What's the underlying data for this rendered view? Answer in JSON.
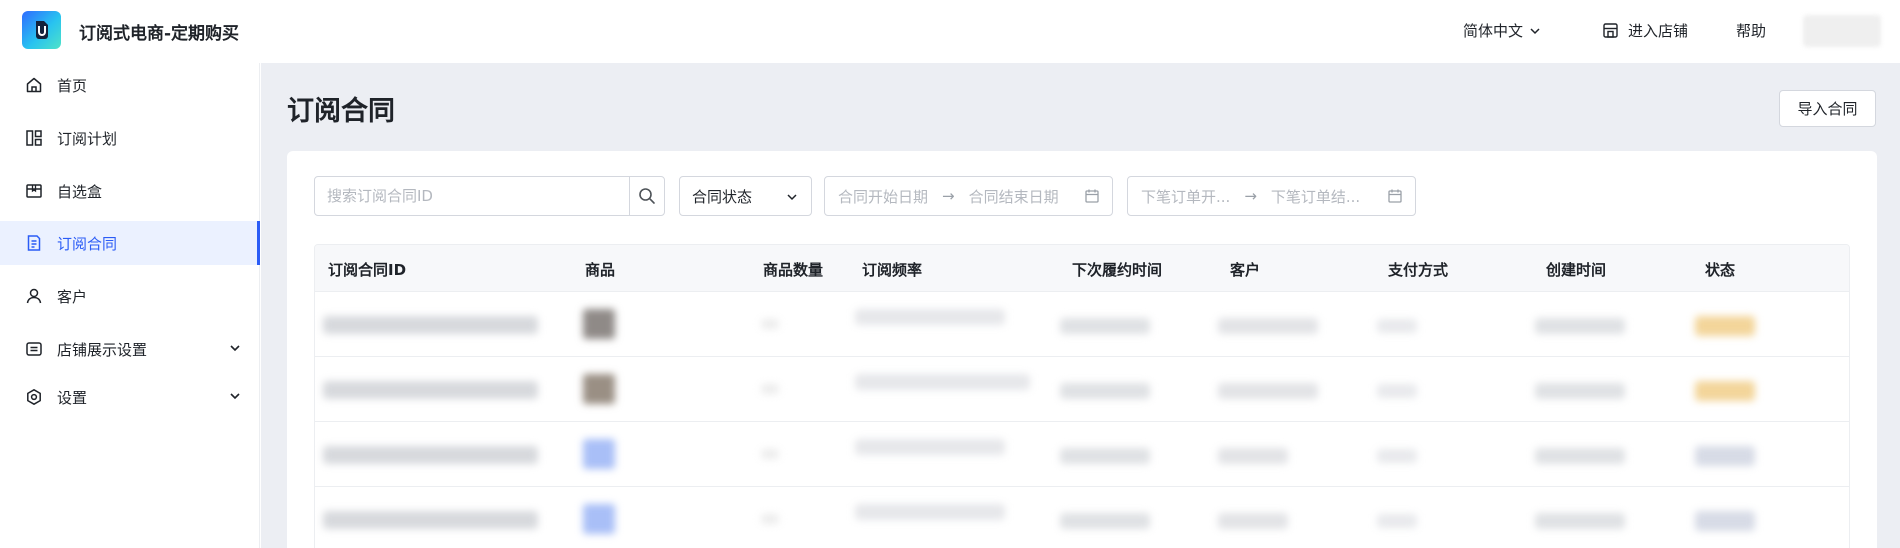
{
  "app": {
    "title": "订阅式电商-定期购买"
  },
  "topbar": {
    "language": "简体中文",
    "enter_store": "进入店铺",
    "help": "帮助"
  },
  "sidebar": {
    "items": [
      {
        "label": "首页",
        "icon": "home-icon"
      },
      {
        "label": "订阅计划",
        "icon": "plan-icon"
      },
      {
        "label": "自选盒",
        "icon": "box-icon"
      },
      {
        "label": "订阅合同",
        "icon": "contract-icon",
        "active": true
      },
      {
        "label": "客户",
        "icon": "user-icon"
      },
      {
        "label": "店铺展示设置",
        "icon": "store-display-icon",
        "expandable": true
      },
      {
        "label": "设置",
        "icon": "settings-icon",
        "expandable": true
      }
    ]
  },
  "main": {
    "title": "订阅合同",
    "import_button": "导入合同",
    "filters": {
      "search_placeholder": "搜索订阅合同ID",
      "status_select": "合同状态",
      "contract_start": "合同开始日期",
      "contract_end": "合同结束日期",
      "order_start": "下笔订单开...",
      "order_end": "下笔订单结...",
      "arrow": "→"
    },
    "table": {
      "columns": [
        "订阅合同ID",
        "商品",
        "商品数量",
        "订阅频率",
        "下次履约时间",
        "客户",
        "支付方式",
        "创建时间",
        "状态"
      ],
      "rows": [
        {
          "product_thumb_color": "#8f8a87",
          "status_color": "#f3d59a"
        },
        {
          "product_thumb_color": "#9a8f84",
          "status_color": "#f3d59a"
        },
        {
          "product_thumb_color": "#a9bff7",
          "status_color": "#d7dbe6"
        },
        {
          "product_thumb_color": "#a9bff7",
          "status_color": "#d7dbe6"
        }
      ]
    }
  },
  "colors": {
    "accent": "#2b5cf6",
    "active_bg": "#ebf1ff",
    "main_bg": "#eceef3"
  }
}
